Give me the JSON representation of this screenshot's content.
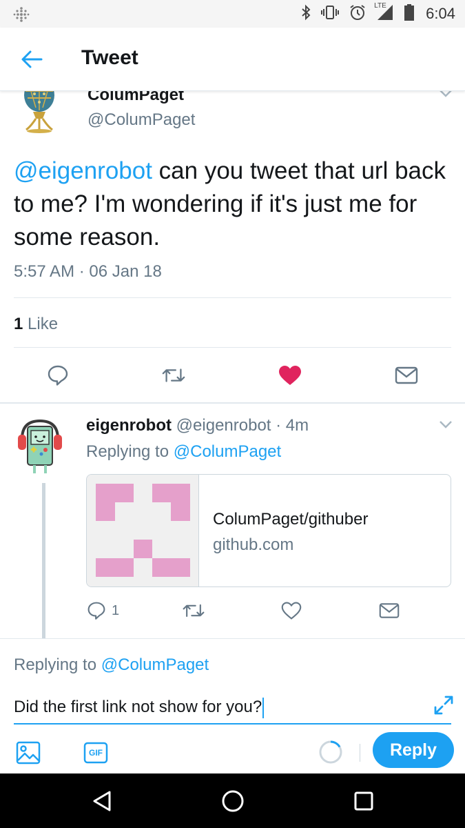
{
  "status_bar": {
    "time": "6:04",
    "lte_label": "LTE",
    "icons": [
      "grid-icon",
      "bluetooth-icon",
      "vibrate-icon",
      "alarm-icon",
      "lte-signal-icon",
      "battery-icon"
    ]
  },
  "header": {
    "title": "Tweet",
    "back_icon": "arrow-left-icon"
  },
  "tweet": {
    "author_name": "ColumPaget",
    "author_handle": "@ColumPaget",
    "mention": "@eigenrobot",
    "text": " can you tweet that url back to me? I'm wondering if it's just me for some reason.",
    "timestamp": "5:57 AM · 06 Jan 18",
    "likes_count": "1",
    "likes_label": "Like",
    "liked": true,
    "actions": [
      "reply-icon",
      "retweet-icon",
      "like-icon",
      "message-icon"
    ]
  },
  "reply": {
    "author_name": "eigenrobot",
    "author_meta": "@eigenrobot · 4m",
    "replying_label": "Replying to",
    "replying_to": "@ColumPaget",
    "card": {
      "title": "ColumPaget/githuber",
      "domain": "github.com"
    },
    "reply_count": "1"
  },
  "compose": {
    "replying_label": "Replying to",
    "replying_to": "@ColumPaget",
    "input_value": "Did the first link not show for you?",
    "reply_button": "Reply",
    "gif_label": "GIF"
  },
  "colors": {
    "accent": "#1da1f2",
    "like": "#e0245e",
    "secondary_text": "#657786",
    "identicon": "#e5a0cb"
  }
}
